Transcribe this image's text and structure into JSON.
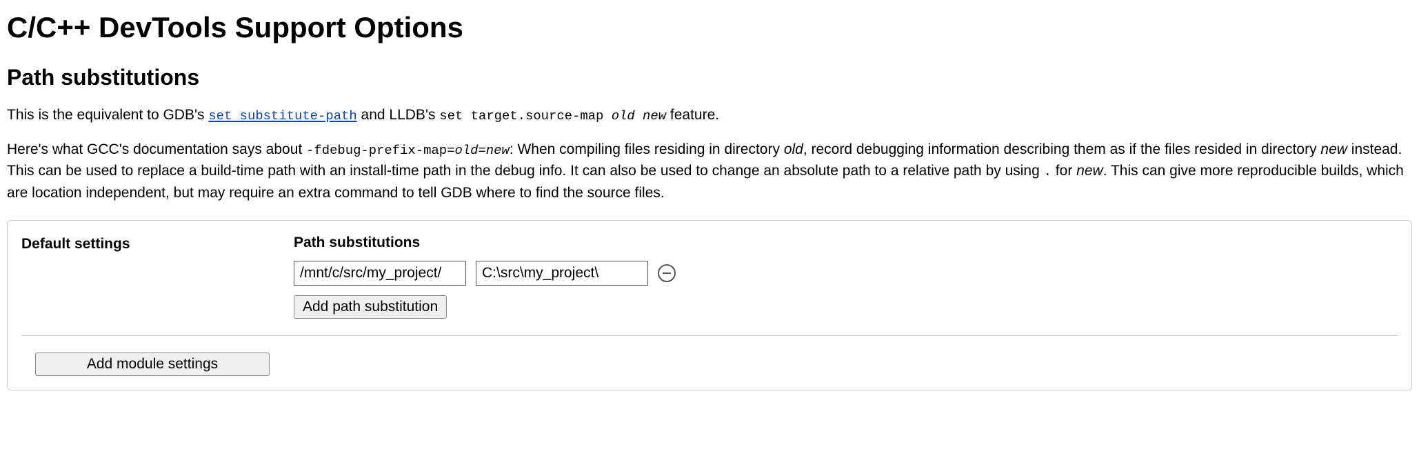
{
  "page": {
    "title": "C/C++ DevTools Support Options",
    "section_heading": "Path substitutions"
  },
  "para1": {
    "t1": "This is the equivalent to GDB's ",
    "link_text": "set substitute-path",
    "t2": " and LLDB's ",
    "code2": "set target.source-map ",
    "code2_em": "old new",
    "t3": " feature."
  },
  "para2": {
    "t1": "Here's what GCC's documentation says about ",
    "code1": "-fdebug-prefix-map=",
    "code1_em": "old=new",
    "t2": ": When compiling files residing in directory ",
    "em1": "old",
    "t3": ", record debugging information describing them as if the files resided in directory ",
    "em2": "new",
    "t4": " instead. This can be used to replace a build-time path with an install-time path in the debug info. It can also be used to change an absolute path to a relative path by using ",
    "code2": ".",
    "t5": " for ",
    "em3": "new",
    "t6": ". This can give more reproducible builds, which are location independent, but may require an extra command to tell GDB where to find the source files."
  },
  "panel": {
    "default_settings_label": "Default settings",
    "path_subs_label": "Path substitutions",
    "substitution": {
      "from": "/mnt/c/src/my_project/",
      "to": "C:\\src\\my_project\\"
    },
    "add_path_btn": "Add path substitution",
    "add_module_btn": "Add module settings"
  }
}
